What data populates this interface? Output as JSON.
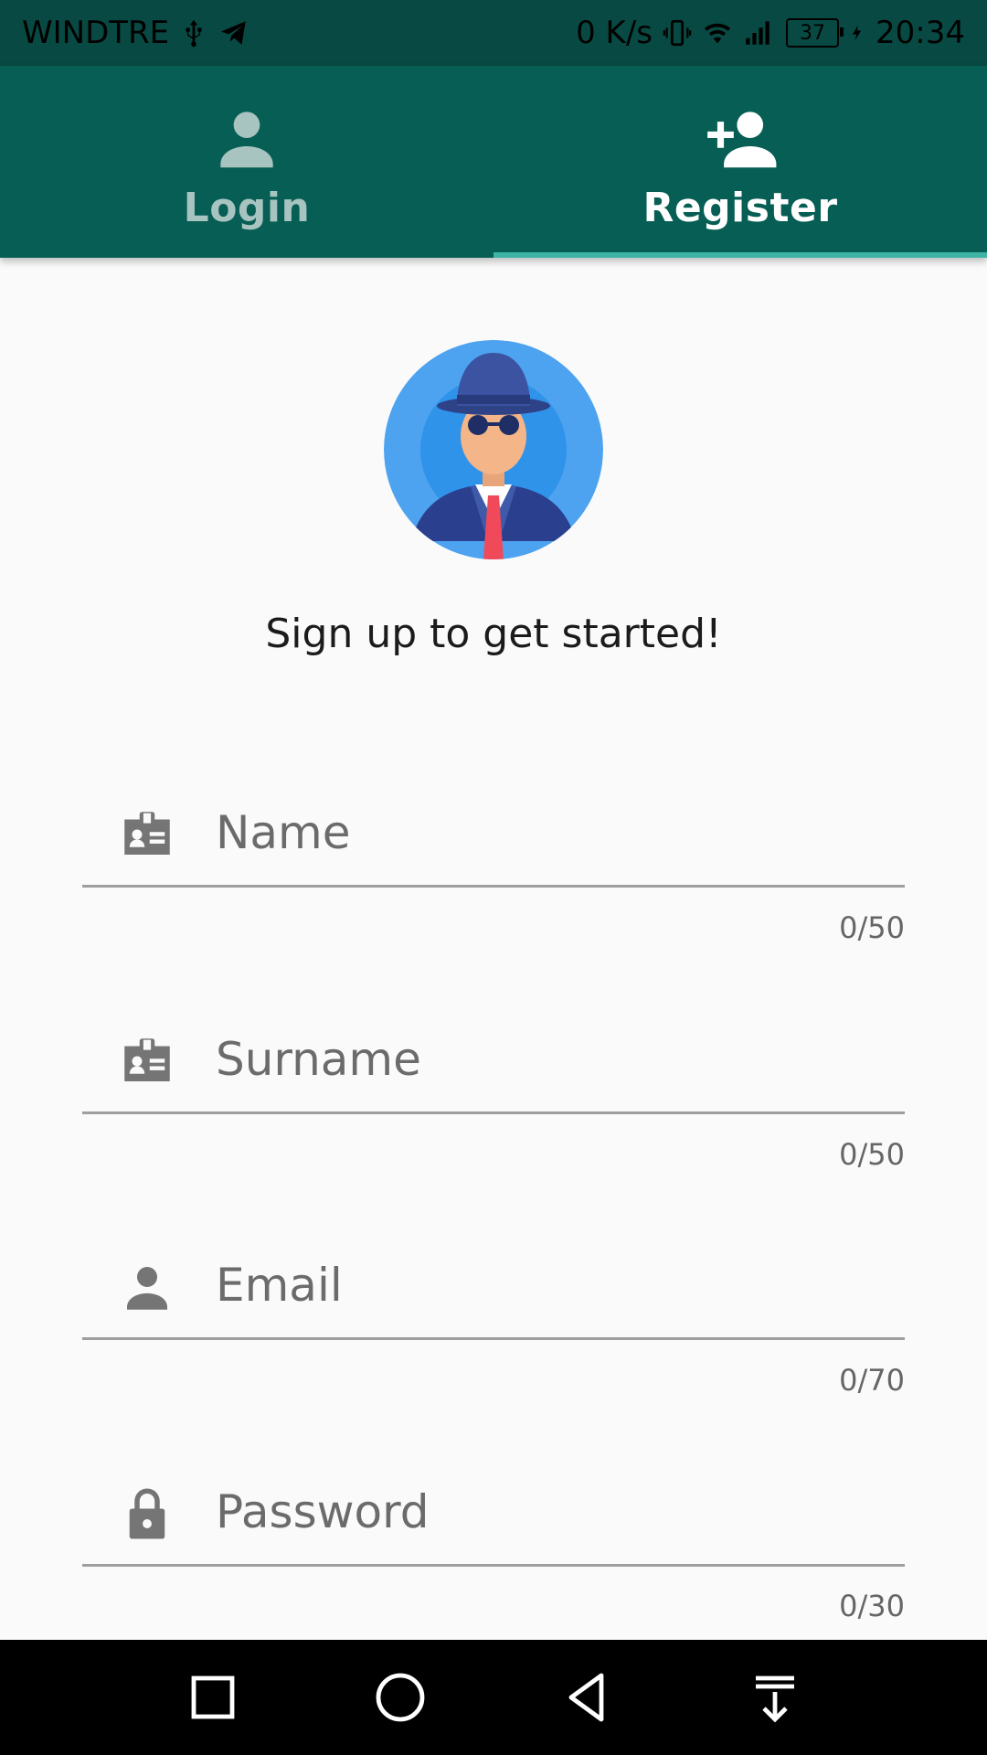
{
  "status_bar": {
    "carrier": "WINDTRE",
    "network_speed": "0 K/s",
    "battery_level": "37",
    "time": "20:34"
  },
  "tabs": [
    {
      "label": "Login",
      "icon": "person-icon",
      "active": false
    },
    {
      "label": "Register",
      "icon": "person-add-icon",
      "active": true
    }
  ],
  "header": {
    "tagline": "Sign up to get started!",
    "avatar_icon": "detective-avatar"
  },
  "form": {
    "fields": [
      {
        "placeholder": "Name",
        "value": "",
        "counter": "0/50",
        "icon": "badge-icon"
      },
      {
        "placeholder": "Surname",
        "value": "",
        "counter": "0/50",
        "icon": "badge-icon"
      },
      {
        "placeholder": "Email",
        "value": "",
        "counter": "0/70",
        "icon": "person-icon"
      },
      {
        "placeholder": "Password",
        "value": "",
        "counter": "0/30",
        "icon": "lock-icon"
      }
    ]
  },
  "nav_bar": {
    "buttons": [
      "recents-icon",
      "home-icon",
      "back-icon",
      "notification-pull-icon"
    ]
  },
  "colors": {
    "status_bar_bg": "#084a43",
    "app_bar_bg": "#075e54",
    "tab_indicator": "#3fb3a4",
    "inactive_tab_text": "#a7c4c0",
    "background": "#fafafa",
    "avatar_bg": "#4da3f0"
  }
}
